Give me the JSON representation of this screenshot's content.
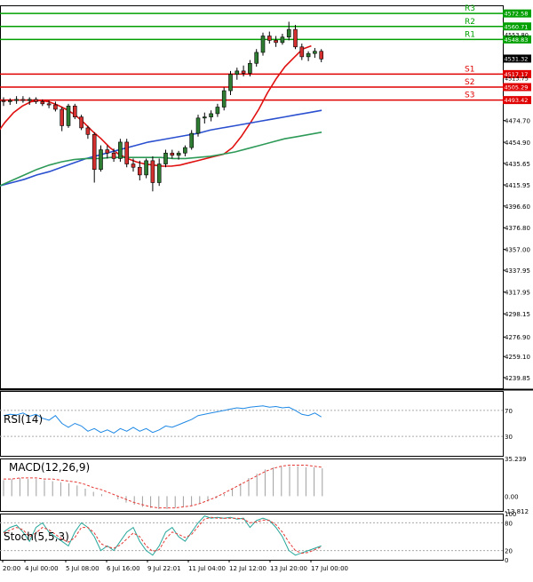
{
  "chart_data": [
    {
      "type": "candlestick",
      "panel": "price",
      "y_ticks": [
        4474.7,
        4454.9,
        4435.65,
        4415.95,
        4396.6,
        4376.8,
        4357.0,
        4337.95,
        4317.95,
        4298.15,
        4276.9,
        4259.1,
        4239.85
      ],
      "ylim": [
        4230,
        4580
      ],
      "levels": [
        {
          "label": "R3",
          "value": 4572.58,
          "color": "#00a000"
        },
        {
          "label": "R2",
          "value": 4560.71,
          "color": "#00a000"
        },
        {
          "label": "R1",
          "value": 4548.83,
          "color": "#00a000"
        },
        {
          "label": "S1",
          "value": 4517.17,
          "color": "#e00000"
        },
        {
          "label": "S2",
          "value": 4505.29,
          "color": "#e00000"
        },
        {
          "label": "S3",
          "value": 4493.42,
          "color": "#e00000"
        }
      ],
      "extra_price_labels": [
        "4553.80",
        "4513.75"
      ],
      "last_price": {
        "value": 4531.32,
        "text": "4531.32"
      },
      "ohlc": [
        [
          4493,
          4496,
          4488,
          4492
        ],
        [
          4492,
          4495,
          4489,
          4493
        ],
        [
          4493,
          4497,
          4490,
          4494
        ],
        [
          4494,
          4497,
          4491,
          4493
        ],
        [
          4493,
          4496,
          4489,
          4494
        ],
        [
          4494,
          4496,
          4490,
          4492
        ],
        [
          4492,
          4494,
          4488,
          4490
        ],
        [
          4490,
          4493,
          4486,
          4489
        ],
        [
          4489,
          4492,
          4483,
          4485
        ],
        [
          4485,
          4487,
          4465,
          4470
        ],
        [
          4470,
          4490,
          4468,
          4488
        ],
        [
          4488,
          4490,
          4476,
          4478
        ],
        [
          4478,
          4480,
          4466,
          4468
        ],
        [
          4468,
          4470,
          4458,
          4462
        ],
        [
          4462,
          4464,
          4418,
          4430
        ],
        [
          4430,
          4452,
          4428,
          4448
        ],
        [
          4448,
          4452,
          4440,
          4445
        ],
        [
          4445,
          4449,
          4437,
          4440
        ],
        [
          4440,
          4458,
          4437,
          4455
        ],
        [
          4455,
          4458,
          4432,
          4435
        ],
        [
          4435,
          4440,
          4428,
          4432
        ],
        [
          4432,
          4438,
          4420,
          4425
        ],
        [
          4425,
          4440,
          4422,
          4438
        ],
        [
          4438,
          4442,
          4410,
          4418
        ],
        [
          4418,
          4440,
          4415,
          4435
        ],
        [
          4435,
          4448,
          4432,
          4445
        ],
        [
          4445,
          4448,
          4440,
          4443
        ],
        [
          4443,
          4447,
          4439,
          4445
        ],
        [
          4445,
          4452,
          4442,
          4450
        ],
        [
          4450,
          4466,
          4448,
          4463
        ],
        [
          4463,
          4480,
          4460,
          4477
        ],
        [
          4477,
          4482,
          4472,
          4478
        ],
        [
          4478,
          4484,
          4474,
          4481
        ],
        [
          4481,
          4490,
          4478,
          4487
        ],
        [
          4487,
          4505,
          4484,
          4502
        ],
        [
          4502,
          4520,
          4498,
          4517
        ],
        [
          4517,
          4523,
          4512,
          4520
        ],
        [
          4520,
          4525,
          4515,
          4518
        ],
        [
          4518,
          4530,
          4515,
          4527
        ],
        [
          4527,
          4540,
          4524,
          4537
        ],
        [
          4537,
          4555,
          4534,
          4552
        ],
        [
          4552,
          4556,
          4545,
          4548
        ],
        [
          4548,
          4552,
          4542,
          4546
        ],
        [
          4546,
          4554,
          4544,
          4551
        ],
        [
          4551,
          4565,
          4548,
          4558
        ],
        [
          4558,
          4562,
          4540,
          4542
        ],
        [
          4542,
          4545,
          4530,
          4533
        ],
        [
          4533,
          4538,
          4529,
          4536
        ],
        [
          4536,
          4541,
          4532,
          4538
        ],
        [
          4538,
          4540,
          4528,
          4531
        ]
      ],
      "ma_fast": {
        "color": "#e01010",
        "values": [
          4450,
          4462,
          4473,
          4482,
          4488,
          4492,
          4493,
          4492,
          4489,
          4485,
          4480,
          4473,
          4465,
          4458,
          4450,
          4444,
          4440,
          4437,
          4435,
          4434,
          4433,
          4433,
          4434,
          4436,
          4438,
          4440,
          4442,
          4444,
          4450,
          4460,
          4472,
          4485,
          4500,
          4513,
          4524,
          4532,
          4540,
          4543
        ]
      },
      "ma_mid": {
        "color": "#2a50d0",
        "values": [
          4415,
          4418,
          4421,
          4425,
          4428,
          4432,
          4436,
          4440,
          4443,
          4446,
          4449,
          4452,
          4455,
          4457,
          4459,
          4461,
          4463,
          4466,
          4468,
          4470,
          4472,
          4474,
          4476,
          4478,
          4480,
          4482,
          4484
        ]
      },
      "ma_slow": {
        "color": "#2e9a58",
        "values": [
          4415,
          4420,
          4425,
          4430,
          4434,
          4437,
          4439,
          4440,
          4440,
          4441,
          4441,
          4441,
          4441,
          4441,
          4440,
          4440,
          4441,
          4442,
          4444,
          4446,
          4449,
          4452,
          4455,
          4458,
          4460,
          4462,
          4464
        ]
      }
    },
    {
      "type": "line",
      "panel": "RSI",
      "title": "RSI(14)",
      "y_ticks": [
        70,
        30
      ],
      "ylim": [
        0,
        100
      ],
      "values": [
        62,
        64,
        63,
        66,
        61,
        64,
        58,
        55,
        62,
        50,
        44,
        50,
        46,
        38,
        42,
        36,
        40,
        35,
        42,
        38,
        44,
        38,
        42,
        36,
        40,
        46,
        44,
        48,
        52,
        56,
        62,
        64,
        66,
        68,
        70,
        72,
        74,
        73,
        75,
        76,
        77,
        75,
        76,
        74,
        75,
        70,
        64,
        62,
        66,
        60
      ]
    },
    {
      "type": "bar+line",
      "panel": "MACD",
      "title": "MACD(12,26,9)",
      "y_ticks": [
        35.239,
        0.0,
        -13.812
      ],
      "ylim": [
        -13.812,
        35.239
      ],
      "histogram": [
        15,
        16,
        17,
        16,
        16,
        15,
        14,
        13,
        12,
        10,
        7,
        4,
        2,
        0,
        -3,
        -6,
        -8,
        -10,
        -11,
        -12,
        -12,
        -11,
        -10,
        -9,
        -7,
        -5,
        -2,
        2,
        7,
        12,
        17,
        21,
        25,
        27,
        28,
        28,
        28,
        27,
        27,
        26
      ],
      "signal": [
        16,
        16,
        17,
        17,
        17,
        16,
        16,
        15,
        14,
        13,
        11,
        8,
        6,
        3,
        0,
        -3,
        -6,
        -8,
        -10,
        -11,
        -11,
        -11,
        -10,
        -9,
        -7,
        -4,
        -1,
        3,
        7,
        11,
        15,
        19,
        23,
        26,
        28,
        29,
        29,
        29,
        28,
        27
      ]
    },
    {
      "type": "line",
      "panel": "Stoch",
      "title": "Stoch(5,5,3)",
      "y_ticks": [
        100,
        80,
        20,
        0
      ],
      "ylim": [
        0,
        100
      ],
      "main": [
        60,
        70,
        75,
        60,
        40,
        70,
        80,
        60,
        50,
        40,
        30,
        60,
        80,
        70,
        50,
        20,
        30,
        20,
        40,
        60,
        70,
        40,
        20,
        10,
        30,
        60,
        70,
        50,
        40,
        60,
        80,
        95,
        90,
        92,
        90,
        92,
        88,
        90,
        70,
        85,
        90,
        85,
        70,
        50,
        20,
        10,
        15,
        20,
        25,
        30
      ],
      "signal": [
        58,
        64,
        70,
        65,
        50,
        58,
        70,
        65,
        55,
        45,
        38,
        48,
        70,
        70,
        58,
        35,
        28,
        25,
        32,
        45,
        58,
        50,
        30,
        18,
        22,
        45,
        60,
        55,
        48,
        55,
        72,
        88,
        92,
        90,
        90,
        90,
        90,
        88,
        80,
        82,
        86,
        85,
        76,
        60,
        38,
        20,
        14,
        16,
        22,
        28
      ]
    }
  ],
  "x_axis": {
    "tick_labels": [
      "20:00",
      "4 Jul 00:00",
      "5 Jul 08:00",
      "6 Jul 16:00",
      "9 Jul 22:01",
      "11 Jul 04:00",
      "12 Jul 12:00",
      "13 Jul 20:00",
      "17 Jul 00:00"
    ]
  }
}
